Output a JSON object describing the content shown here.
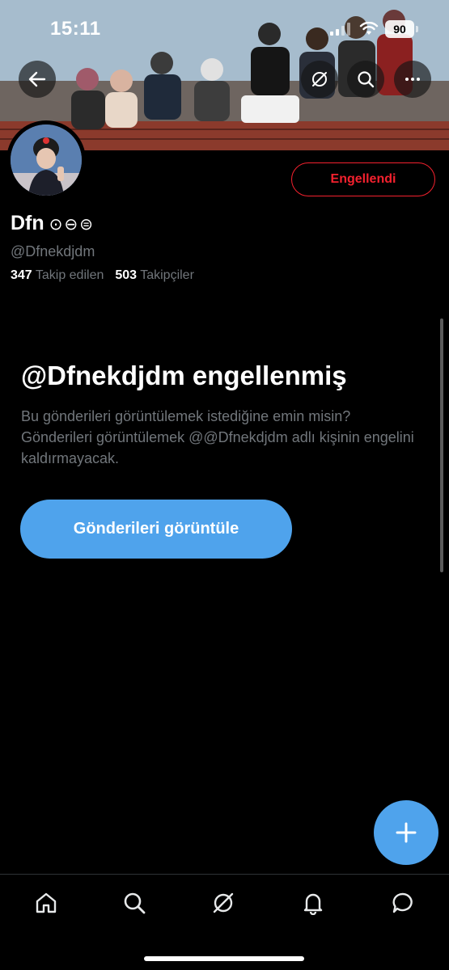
{
  "status_bar": {
    "time": "15:11",
    "battery": "90",
    "signal_icon": "signal-icon",
    "wifi_icon": "wifi-icon"
  },
  "header": {
    "back_icon": "arrow-left-icon",
    "actions": [
      "grok-icon",
      "search-icon",
      "more-icon"
    ]
  },
  "profile": {
    "display_name": "Dfn",
    "name_emojis": "⊙⊖⊜",
    "handle": "@Dfnekdjdm",
    "following_count": "347",
    "following_label": "Takip edilen",
    "followers_count": "503",
    "followers_label": "Takipçiler",
    "blocked_button_label": "Engellendi"
  },
  "blocked_notice": {
    "title": "@Dfnekdjdm engellenmiş",
    "description": "Bu gönderileri görüntülemek istediğine emin misin? Gönderileri görüntülemek @@Dfnekdjdm adlı kişinin engelini kaldırmayacak.",
    "button_label": "Gönderileri görüntüle"
  },
  "fab": {
    "icon": "plus-icon"
  },
  "bottom_nav": [
    "home-icon",
    "search-icon",
    "grok-icon",
    "bell-icon",
    "messages-icon"
  ],
  "colors": {
    "background": "#000000",
    "accent_blue": "#4fa3ec",
    "blocked_red": "#f4212e",
    "secondary_text": "#71767b"
  }
}
